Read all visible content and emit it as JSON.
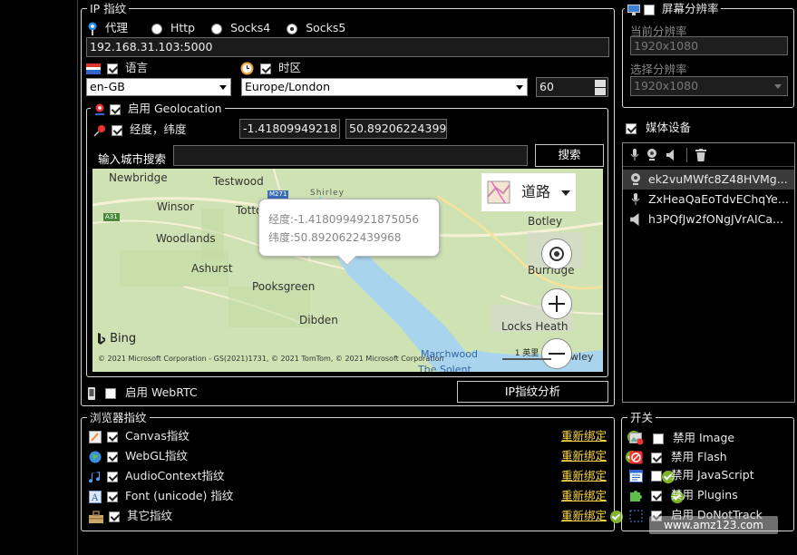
{
  "ip": {
    "title": "IP 指纹",
    "proxy_label": "代理",
    "options": [
      "Http",
      "Socks4",
      "Socks5"
    ],
    "selected": "Socks5",
    "address": "192.168.31.103:5000"
  },
  "locale": {
    "language_label": "语言",
    "language_value": "en-GB",
    "timezone_label": "时区",
    "timezone_value": "Europe/London",
    "offset_value": "60"
  },
  "geo": {
    "enable_label": "启用 Geolocation",
    "latlon_label": "经度，纬度",
    "longitude": "-1.41809949218",
    "latitude": "50.89206224399",
    "search_label": "输入城市搜索",
    "search_placeholder": "",
    "search_button": "搜索"
  },
  "map": {
    "places": [
      "Newbridge",
      "Testwood",
      "Totton",
      "Winsor",
      "Woodlands",
      "Ashurst",
      "Pooksgreen",
      "Dibden",
      "Botley",
      "Burridge",
      "Locks Heath",
      "Fawley",
      "Marchwood",
      "Shirley"
    ],
    "road_badge": "M271",
    "road_badge2": "A31",
    "map_type": "道路",
    "popup_lon": "经度:-1.4180994921875056",
    "popup_lat": "纬度:50.8920622439968",
    "logo": "Bing",
    "copyright": "© 2021 Microsoft Corporation - GS(2021)1731, © 2021 TomTom, © 2021 Microsoft Corporation",
    "terms": "The Solent",
    "scale_label": "1 英里"
  },
  "webrtc": {
    "label": "启用 WebRTC",
    "analyze_button": "IP指纹分析"
  },
  "screen": {
    "title": "屏幕分辨率",
    "current_label": "当前分辨率",
    "current_value": "1920x1080",
    "select_label": "选择分辨率",
    "select_value": "1920x1080"
  },
  "media": {
    "label": "媒体设备",
    "devices": [
      "ek2vuMWfc8Z48HVMg...",
      "ZxHeaQaEoTdvEChqYe...",
      "h3PQfJw2fONgJVrAICa..."
    ]
  },
  "browser_fp": {
    "title": "浏览器指纹",
    "items": [
      "Canvas指纹",
      "WebGL指纹",
      "AudioContext指纹",
      "Font (unicode) 指纹",
      "其它指纹"
    ],
    "rebind_label": "重新绑定"
  },
  "switches": {
    "title": "开关",
    "items": [
      {
        "label": "禁用 Image",
        "checked": false
      },
      {
        "label": "禁用 Flash",
        "checked": true
      },
      {
        "label": "禁用 JavaScript",
        "checked": false
      },
      {
        "label": "禁用 Plugins",
        "checked": true
      },
      {
        "label": "启用 DoNotTrack",
        "checked": true
      }
    ]
  },
  "watermark": "www.amz123.com",
  "colors": {
    "accent": "#ffd84a",
    "map_water": "#a8d4ee",
    "map_land": "#cfe2b4",
    "ok_green": "#7fb32a"
  }
}
